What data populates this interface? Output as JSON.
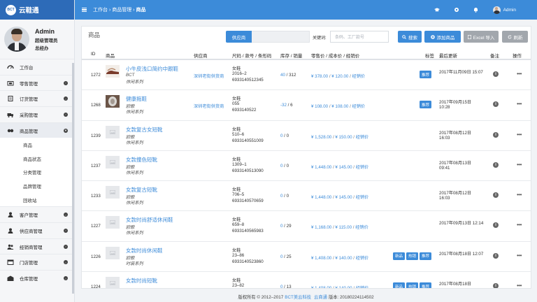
{
  "brand": {
    "logo_text": "BCT",
    "name": "云鞋通"
  },
  "profile": {
    "name": "Admin",
    "role": "超级管理员",
    "position": "总经办"
  },
  "nav": {
    "items": [
      {
        "label": "工作台",
        "icon": "dashboard-icon",
        "has_chevron": false
      },
      {
        "label": "零售管理",
        "icon": "retail-icon",
        "has_chevron": true
      },
      {
        "label": "订货管理",
        "icon": "cart-icon",
        "has_chevron": true
      },
      {
        "label": "采购管理",
        "icon": "truck-icon",
        "has_chevron": true
      },
      {
        "label": "商品管理",
        "icon": "product-icon",
        "has_chevron": true,
        "expanded": true
      }
    ],
    "sub_items": [
      "商品",
      "商品状态",
      "分类管理",
      "品牌管理",
      "回收站"
    ],
    "items_after": [
      {
        "label": "客户管理",
        "icon": "customer-icon",
        "has_chevron": true
      },
      {
        "label": "供应商管理",
        "icon": "supplier-icon",
        "has_chevron": true
      },
      {
        "label": "经销商管理",
        "icon": "dealer-icon",
        "has_chevron": true
      },
      {
        "label": "门店管理",
        "icon": "store-icon",
        "has_chevron": true
      },
      {
        "label": "仓库管理",
        "icon": "warehouse-icon",
        "has_chevron": true
      }
    ]
  },
  "topbar": {
    "breadcrumb": [
      "工作台",
      "商品管理",
      "商品"
    ],
    "user": "Admin"
  },
  "panel": {
    "title": "商品",
    "supplier_button": "供应商",
    "keyword_label": "关键词:",
    "keyword_placeholder": "条码、工厂款号",
    "search_button": "搜索",
    "add_button": "添加商品",
    "excel_button": "Excel 导入",
    "refresh_button": "刷新"
  },
  "table": {
    "headers": [
      "ID",
      "商品",
      "供应商",
      "尺码 / 款号 / 条形码",
      "库存 / 销量",
      "零售价 / 成本价 / 经销价",
      "标签",
      "最后更新",
      "备注",
      "操作"
    ],
    "rows": [
      {
        "id": "1272",
        "name": "小牛皮浅口简约中跟鞋",
        "brand": "BCT",
        "series": "休闲系列",
        "supplier": "深圳老街供货商",
        "size": "女鞋",
        "style": "2016–2",
        "barcode": "6933140512345",
        "stock": "40",
        "sales": "312",
        "retail": "¥ 378.00",
        "cost": "¥ 120.00",
        "dealer": "经销价",
        "tags": [
          "推荐"
        ],
        "updated_date": "2017年11月09日 15:07",
        "updated_time": "",
        "thumb": "photo"
      },
      {
        "id": "1268",
        "name": "健康拖鞋",
        "brand": "欧歌",
        "series": "休闲系列",
        "supplier": "深圳老街供货商",
        "size": "女鞋",
        "style": "055",
        "barcode": "6933140522",
        "stock": "-32",
        "sales": "6",
        "retail": "¥ 108.00",
        "cost": "¥ 108.00",
        "dealer": "经销价",
        "tags": [
          "推荐"
        ],
        "updated_date": "2017年09月15日",
        "updated_time": "10:28",
        "thumb": "photo2"
      },
      {
        "id": "1239",
        "name": "女款复古女短靴",
        "brand": "欧歌",
        "series": "休闲系列",
        "supplier": "",
        "size": "女鞋",
        "style": "510–6",
        "barcode": "6933140551009",
        "stock": "0",
        "sales": "0",
        "retail": "¥ 1,528.00",
        "cost": "¥ 150.00",
        "dealer": "经销价",
        "tags": [],
        "updated_date": "2017年08月12日",
        "updated_time": "16:03",
        "thumb": "placeholder"
      },
      {
        "id": "1237",
        "name": "女款撞色短靴",
        "brand": "欧歌",
        "series": "休闲系列",
        "supplier": "",
        "size": "女鞋",
        "style": "1309–1",
        "barcode": "6933140513090",
        "stock": "0",
        "sales": "0",
        "retail": "¥ 1,448.00",
        "cost": "¥ 145.00",
        "dealer": "经销价",
        "tags": [],
        "updated_date": "2017年08月13日",
        "updated_time": "09:41",
        "thumb": "placeholder"
      },
      {
        "id": "1233",
        "name": "女款复古短靴",
        "brand": "欧歌",
        "series": "休闲系列",
        "supplier": "",
        "size": "女鞋",
        "style": "706–5",
        "barcode": "6933140570659",
        "stock": "0",
        "sales": "0",
        "retail": "¥ 1,448.00",
        "cost": "¥ 145.00",
        "dealer": "经销价",
        "tags": [],
        "updated_date": "2017年08月12日",
        "updated_time": "16:03",
        "thumb": "placeholder"
      },
      {
        "id": "1227",
        "name": "女款时尚舒适休闲鞋",
        "brand": "欧歌",
        "series": "休闲系列",
        "supplier": "",
        "size": "女鞋",
        "style": "659–8",
        "barcode": "6933140565983",
        "stock": "0",
        "sales": "29",
        "retail": "¥ 1,168.00",
        "cost": "¥ 115.00",
        "dealer": "经销价",
        "tags": [],
        "updated_date": "2017年09月13日 12:14",
        "updated_time": "",
        "thumb": "placeholder"
      },
      {
        "id": "1226",
        "name": "女款时尚休闲鞋",
        "brand": "欧歌",
        "series": "时装系列",
        "supplier": "",
        "size": "女鞋",
        "style": "23–86",
        "barcode": "6933140523860",
        "stock": "0",
        "sales": "25",
        "retail": "¥ 1,408.00",
        "cost": "¥ 140.00",
        "dealer": "经销价",
        "tags": [
          "新品",
          "热销",
          "推荐"
        ],
        "updated_date": "2017年08月18日 12:07",
        "updated_time": "",
        "thumb": "placeholder"
      },
      {
        "id": "1224",
        "name": "女款时尚短靴",
        "brand": "",
        "series": "",
        "supplier": "",
        "size": "女鞋",
        "style": "23–82",
        "barcode": "",
        "stock": "0",
        "sales": "13",
        "retail": "¥ 1,408.00",
        "cost": "¥ 140.00",
        "dealer": "经销价",
        "tags": [
          "新品",
          "热销",
          "推荐"
        ],
        "updated_date": "2017年08月18日",
        "updated_time": "",
        "thumb": "placeholder"
      }
    ]
  },
  "footer": {
    "prefix": "版权所有 © 2012–2017",
    "company": "BCT美云科技",
    "product": "云商通",
    "version": "版本: 20180224114502"
  },
  "colors": {
    "primary": "#3c8bd9",
    "brand_bar": "#2d6bb8",
    "muted_button": "#a2a7ad"
  }
}
